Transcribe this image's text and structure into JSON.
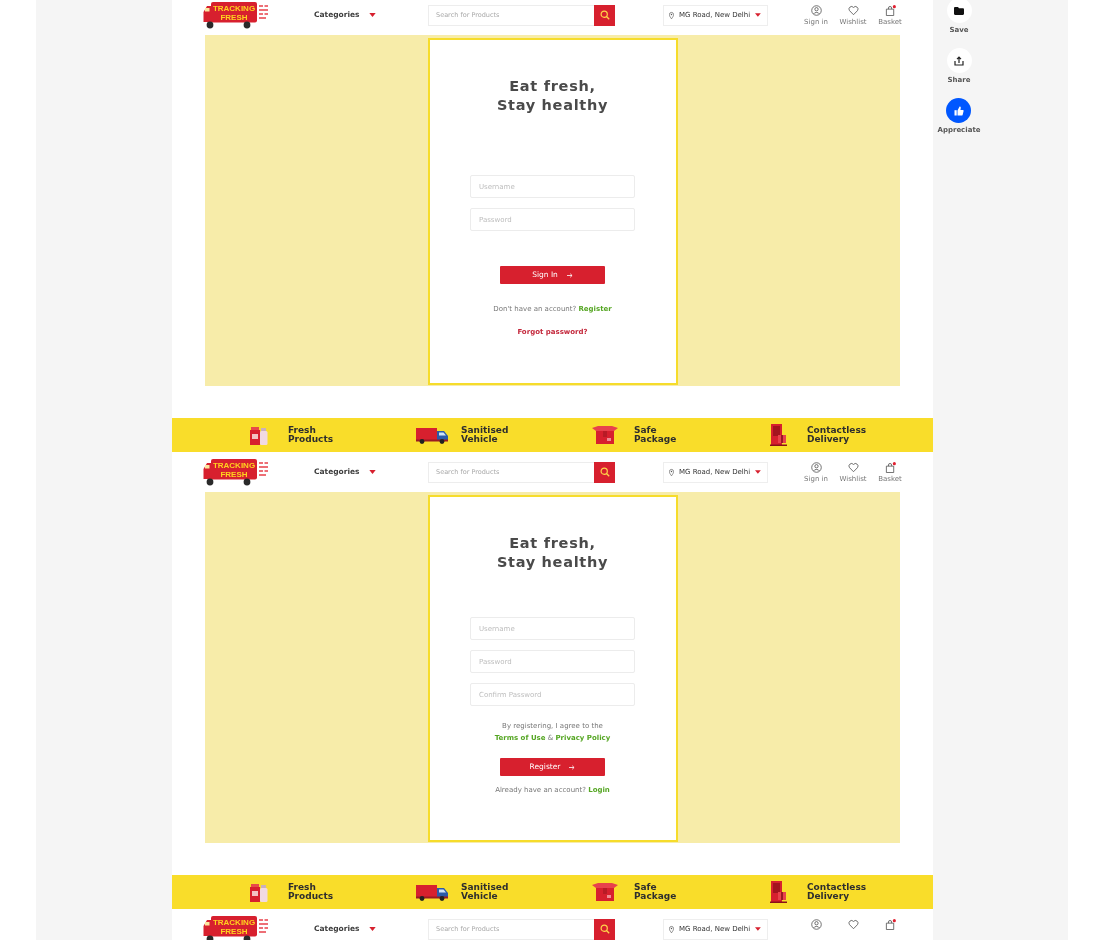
{
  "page": [
    {
      "kind": "header",
      "logo": {
        "lines": [
          "TRACKING",
          "FRESH"
        ]
      },
      "categories": "Categories",
      "search": {
        "placeholder": "Search for Products"
      },
      "location": "MG Road, New Delhi",
      "nav": [
        {
          "kind": "account",
          "label": "Sign in"
        },
        {
          "kind": "wishlist",
          "label": "Wishlist"
        },
        {
          "kind": "basket",
          "label": "Basket"
        }
      ]
    },
    {
      "kind": "login_form",
      "title": "Eat fresh,\nStay healthy",
      "fields": [
        {
          "placeholder": "Username"
        },
        {
          "placeholder": "Password"
        }
      ],
      "button": "Sign In",
      "prompt": {
        "text": "Don't have an account?",
        "link": "Register"
      },
      "extra_link": "Forgot password?"
    },
    {
      "kind": "features",
      "items": [
        {
          "kind": "products",
          "title": "Fresh Products"
        },
        {
          "kind": "vehicle",
          "title": "Sanitised Vehicle"
        },
        {
          "kind": "package",
          "title": "Safe Package"
        },
        {
          "kind": "delivery",
          "title": "Contactless Delivery"
        }
      ]
    },
    {
      "kind": "header",
      "logo": {
        "lines": [
          "TRACKING",
          "FRESH"
        ]
      },
      "categories": "Categories",
      "search": {
        "placeholder": "Search for Products"
      },
      "location": "MG Road, New Delhi",
      "nav": [
        {
          "kind": "account",
          "label": "Sign in"
        },
        {
          "kind": "wishlist",
          "label": "Wishlist"
        },
        {
          "kind": "basket",
          "label": "Basket"
        }
      ]
    },
    {
      "kind": "register_form",
      "title": "Eat fresh,\nStay healthy",
      "fields": [
        {
          "placeholder": "Username"
        },
        {
          "placeholder": "Password"
        },
        {
          "placeholder": "Confirm Password"
        }
      ],
      "agreement": {
        "text": "By registering, I agree to the",
        "links": [
          "Terms of Use",
          "Privacy Policy"
        ],
        "joiner": "&"
      },
      "button": "Register",
      "prompt": {
        "text": "Already have an account?",
        "link": "Login"
      }
    },
    {
      "kind": "features",
      "items": [
        {
          "kind": "products",
          "title": "Fresh Products"
        },
        {
          "kind": "vehicle",
          "title": "Sanitised Vehicle"
        },
        {
          "kind": "package",
          "title": "Safe Package"
        },
        {
          "kind": "delivery",
          "title": "Contactless Delivery"
        }
      ]
    },
    {
      "kind": "header",
      "logo": {
        "lines": [
          "TRACKING",
          "FRESH"
        ]
      },
      "categories": "Categories",
      "search": {
        "placeholder": "Search for Products"
      },
      "location": "MG Road, New Delhi",
      "nav": [
        {
          "kind": "account"
        },
        {
          "kind": "wishlist"
        },
        {
          "kind": "basket"
        }
      ]
    }
  ],
  "actions": [
    {
      "kind": "save",
      "label": "Save"
    },
    {
      "kind": "share",
      "label": "Share"
    },
    {
      "kind": "appreciate",
      "label": "Appreciate"
    }
  ]
}
